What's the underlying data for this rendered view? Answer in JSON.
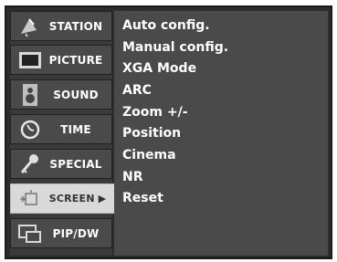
{
  "tabs": [
    {
      "label": "STATION",
      "icon": "satellite-dish-icon"
    },
    {
      "label": "PICTURE",
      "icon": "tv-screen-icon"
    },
    {
      "label": "SOUND",
      "icon": "speaker-icon"
    },
    {
      "label": "TIME",
      "icon": "clock-icon"
    },
    {
      "label": "SPECIAL",
      "icon": "key-icon"
    },
    {
      "label": "SCREEN ▶",
      "icon": "screen-adjust-icon",
      "active": true
    },
    {
      "label": "PIP/DW",
      "icon": "pip-icon"
    }
  ],
  "submenu": {
    "items": [
      "Auto config.",
      "Manual config.",
      "XGA Mode",
      "ARC",
      "Zoom +/-",
      "Position",
      "Cinema",
      "NR",
      "Reset"
    ]
  }
}
